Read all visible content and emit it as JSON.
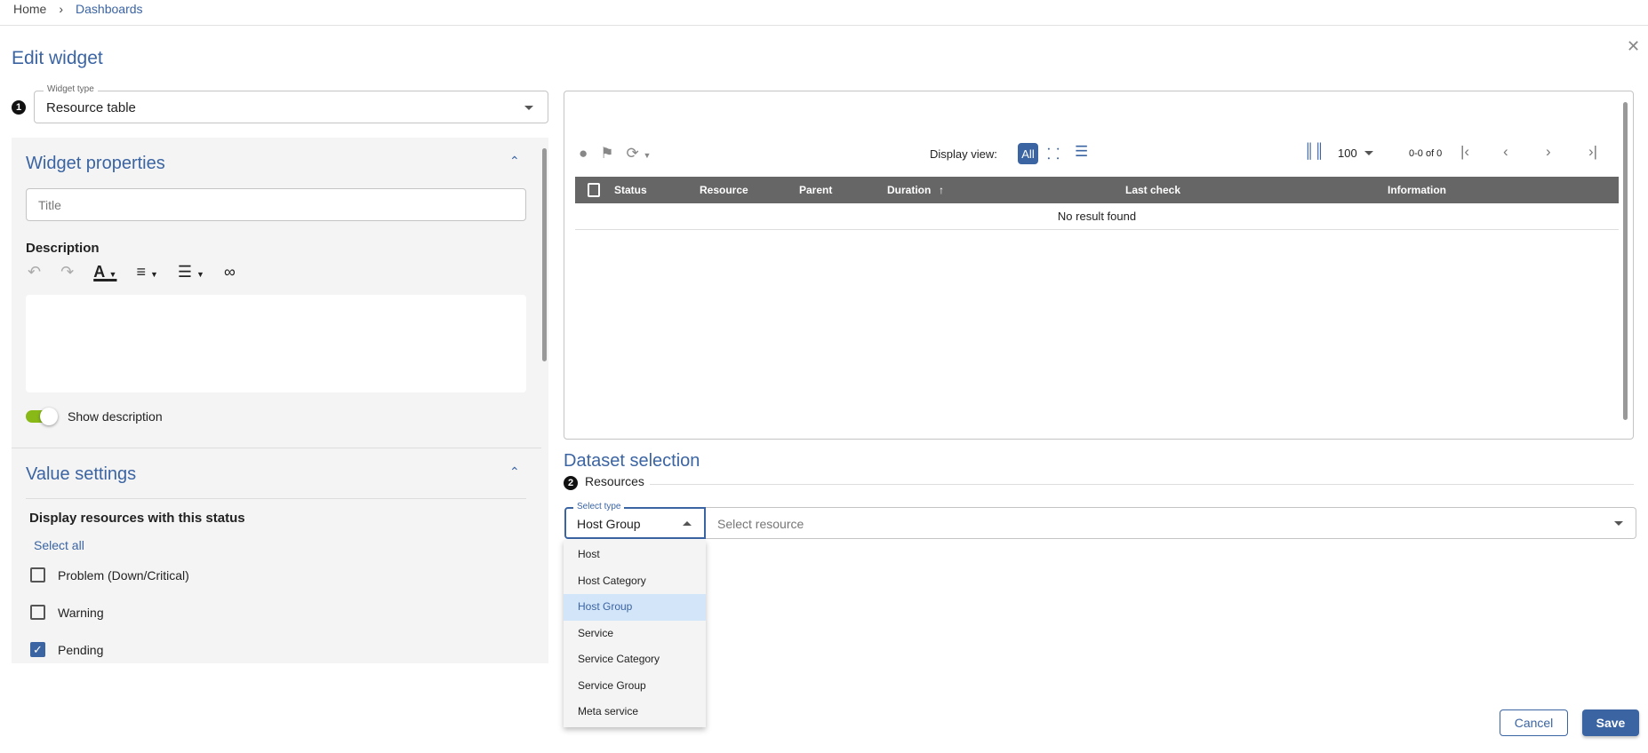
{
  "breadcrumb": {
    "home": "Home",
    "current": "Dashboards"
  },
  "page_title": "Edit widget",
  "widget_type": {
    "badge": "1",
    "label": "Widget type",
    "value": "Resource table"
  },
  "widget_properties": {
    "heading": "Widget properties",
    "title_placeholder": "Title",
    "description_label": "Description",
    "show_description_label": "Show description",
    "show_description_on": true
  },
  "value_settings": {
    "heading": "Value settings",
    "status_heading": "Display resources with this status",
    "select_all": "Select all",
    "statuses": [
      {
        "label": "Problem (Down/Critical)",
        "checked": false
      },
      {
        "label": "Warning",
        "checked": false
      },
      {
        "label": "Pending",
        "checked": true
      }
    ]
  },
  "preview": {
    "display_view_label": "Display view:",
    "view_all": "All",
    "page_size": "100",
    "pagination": "0-0 of 0",
    "columns": [
      "Status",
      "Resource",
      "Parent",
      "Duration",
      "Last check",
      "Information"
    ],
    "empty_message": "No result found"
  },
  "dataset": {
    "heading": "Dataset selection",
    "badge": "2",
    "resources_label": "Resources",
    "select_type_label": "Select type",
    "select_type_value": "Host Group",
    "resource_placeholder": "Select resource",
    "options": [
      "Host",
      "Host Category",
      "Host Group",
      "Service",
      "Service Category",
      "Service Group",
      "Meta service"
    ],
    "selected_option": "Host Group"
  },
  "actions": {
    "cancel": "Cancel",
    "save": "Save"
  },
  "colors": {
    "primary": "#3b64a3",
    "toggle": "#88b917",
    "table_header": "#666666",
    "highlight": "#d3e5f8"
  }
}
